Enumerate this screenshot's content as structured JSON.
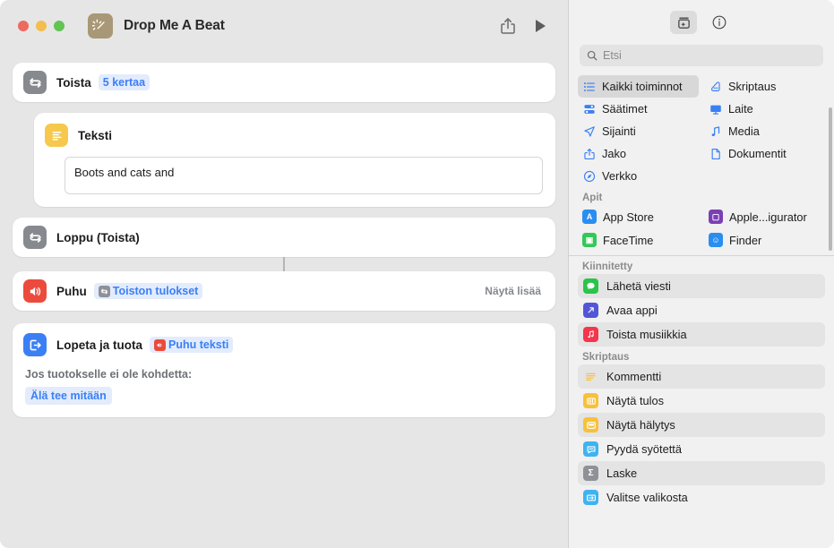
{
  "window": {
    "title": "Drop Me A Beat",
    "app_icon": "magic-wand-icon",
    "traffic_lights": [
      "close",
      "minimize",
      "zoom"
    ],
    "share_icon": "share-icon",
    "run_icon": "play-icon"
  },
  "workflow": {
    "repeat": {
      "icon": "repeat-icon",
      "title": "Toista",
      "count_token": "5 kertaa"
    },
    "text": {
      "icon": "text-icon",
      "title": "Teksti",
      "value": "Boots and cats and"
    },
    "end_repeat": {
      "icon": "repeat-icon",
      "title": "Loppu (Toista)"
    },
    "speak": {
      "icon": "speaker-icon",
      "title": "Puhu",
      "token_icon": "repeat-icon",
      "token": "Toiston tulokset",
      "show_more": "Näytä lisää"
    },
    "stop_and_output": {
      "icon": "exit-icon",
      "title": "Lopeta ja tuota",
      "token_icon": "speaker-icon",
      "token": "Puhu teksti",
      "sub_label": "Jos tuotokselle ei ole kohdetta:",
      "fallback": "Älä tee mitään"
    }
  },
  "sidebar": {
    "toolbar": {
      "library_icon": "action-library-icon",
      "info_icon": "info-circle-icon"
    },
    "search": {
      "icon": "search-icon",
      "placeholder": "Etsi",
      "value": ""
    },
    "categories": [
      {
        "label": "Kaikki toiminnot",
        "icon": "list-bullet-icon",
        "selected": true
      },
      {
        "label": "Skriptaus",
        "icon": "script-icon",
        "selected": false
      },
      {
        "label": "Säätimet",
        "icon": "sliders-icon",
        "selected": false
      },
      {
        "label": "Laite",
        "icon": "display-icon",
        "selected": false
      },
      {
        "label": "Sijainti",
        "icon": "location-arrow-icon",
        "selected": false
      },
      {
        "label": "Media",
        "icon": "music-note-icon",
        "selected": false
      },
      {
        "label": "Jako",
        "icon": "share-icon",
        "selected": false
      },
      {
        "label": "Dokumentit",
        "icon": "document-icon",
        "selected": false
      },
      {
        "label": "Verkko",
        "icon": "safari-compass-icon",
        "selected": false
      }
    ],
    "apps_section": {
      "header": "Apit",
      "items": [
        {
          "label": "App Store",
          "icon": "app-store-icon",
          "color": "#2a8ef0"
        },
        {
          "label": "Apple...igurator",
          "icon": "apple-configurator-icon",
          "color": "#7b3fb5"
        },
        {
          "label": "FaceTime",
          "icon": "facetime-icon",
          "color": "#34c759"
        },
        {
          "label": "Finder",
          "icon": "finder-icon",
          "color": "#2a8ef0"
        }
      ]
    },
    "pinned_section": {
      "header": "Kiinnitetty",
      "items": [
        {
          "label": "Lähetä viesti",
          "icon": "messages-icon",
          "color": "#2ac44a",
          "alt": true
        },
        {
          "label": "Avaa appi",
          "icon": "open-app-icon",
          "color": "#5356d6",
          "alt": false
        },
        {
          "label": "Toista musiikkia",
          "icon": "music-icon",
          "color": "#f4364c",
          "alt": true
        }
      ]
    },
    "scripting_section": {
      "header": "Skriptaus",
      "items": [
        {
          "label": "Kommentti",
          "icon": "comment-icon",
          "color": "#ffffff",
          "alt": true
        },
        {
          "label": "Näytä tulos",
          "icon": "show-result-icon",
          "color": "#f7c13c",
          "alt": false
        },
        {
          "label": "Näytä hälytys",
          "icon": "show-alert-icon",
          "color": "#f7c13c",
          "alt": true
        },
        {
          "label": "Pyydä syötettä",
          "icon": "ask-input-icon",
          "color": "#3fb3f0",
          "alt": false
        },
        {
          "label": "Laske",
          "icon": "calculate-icon",
          "color": "#8e9196",
          "alt": true
        },
        {
          "label": "Valitse valikosta",
          "icon": "choose-menu-icon",
          "color": "#3fb3f0",
          "alt": false
        }
      ]
    }
  },
  "colors": {
    "accent_blue": "#3b7ff5",
    "token_bg": "#e3ecfd",
    "window_bg": "#e6e6e6",
    "sidebar_bg": "#f1f1f1",
    "app_icon_bg": "#a99877"
  }
}
